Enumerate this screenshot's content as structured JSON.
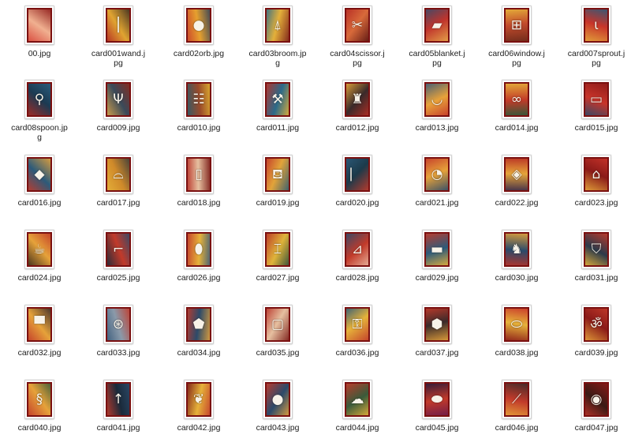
{
  "files": [
    {
      "name": "00.jpg",
      "icon": "red-swirl-icon",
      "glyph": "",
      "colors": [
        "#d8463a",
        "#f0b090",
        "#8e1c1a"
      ]
    },
    {
      "name": "card001wand.jpg",
      "icon": "wand-icon",
      "glyph": "⎮",
      "colors": [
        "#b32a22",
        "#e0a431",
        "#3a2a20"
      ]
    },
    {
      "name": "card02orb.jpg",
      "icon": "orb-icon",
      "glyph": "●",
      "colors": [
        "#c8402a",
        "#e6a02e",
        "#30405a"
      ]
    },
    {
      "name": "card03broom.jpg",
      "icon": "broom-icon",
      "glyph": "⍋",
      "colors": [
        "#2f6b8a",
        "#e4b03a",
        "#7a1c18"
      ]
    },
    {
      "name": "card04scissor.jpg",
      "icon": "scissor-icon",
      "glyph": "✂",
      "colors": [
        "#b52a24",
        "#d86a3a",
        "#5a1512"
      ]
    },
    {
      "name": "card05blanket.jpg",
      "icon": "blanket-icon",
      "glyph": "▰",
      "colors": [
        "#3a4a6a",
        "#c0342c",
        "#e6a84a"
      ]
    },
    {
      "name": "card06window.jpg",
      "icon": "window-icon",
      "glyph": "⊞",
      "colors": [
        "#e7b43a",
        "#c24a2c",
        "#6a2a1a"
      ]
    },
    {
      "name": "card007sprout.jpg",
      "icon": "sprout-icon",
      "glyph": "ɩ",
      "colors": [
        "#2a5a7a",
        "#c8342a",
        "#e3a63a"
      ]
    },
    {
      "name": "card08spoon.jpg",
      "icon": "spoon-icon",
      "glyph": "⚲",
      "colors": [
        "#2c5f80",
        "#1c3a52",
        "#a72a22"
      ]
    },
    {
      "name": "card009.jpg",
      "icon": "fork-icon",
      "glyph": "Ψ",
      "colors": [
        "#8a2a1c",
        "#3a4a5a",
        "#d8a44a"
      ]
    },
    {
      "name": "card010.jpg",
      "icon": "ladder-icon",
      "glyph": "☷",
      "colors": [
        "#e0b230",
        "#9a4a2a",
        "#2a5a6a"
      ]
    },
    {
      "name": "card011.jpg",
      "icon": "shovel-icon",
      "glyph": "⚒",
      "colors": [
        "#e6b234",
        "#2c6a8a",
        "#b83226"
      ]
    },
    {
      "name": "card012.jpg",
      "icon": "lamp-icon",
      "glyph": "♜",
      "colors": [
        "#b52e24",
        "#3a2a2a",
        "#e8a63a"
      ]
    },
    {
      "name": "card013.jpg",
      "icon": "bowl-icon",
      "glyph": "◡",
      "colors": [
        "#c4382a",
        "#e8a23a",
        "#3a5a7a"
      ]
    },
    {
      "name": "card014.jpg",
      "icon": "eggs-icon",
      "glyph": "∞",
      "colors": [
        "#2a5a3a",
        "#c23a28",
        "#e6b23a"
      ]
    },
    {
      "name": "card015.jpg",
      "icon": "rectangle-icon",
      "glyph": "▭",
      "colors": [
        "#2a4a6a",
        "#c8342a",
        "#8a1a18"
      ]
    },
    {
      "name": "card016.jpg",
      "icon": "cube-icon",
      "glyph": "◆",
      "colors": [
        "#c23a2a",
        "#2c5a7a",
        "#e6a23a"
      ]
    },
    {
      "name": "card017.jpg",
      "icon": "hat-icon",
      "glyph": "⌓",
      "colors": [
        "#e6b23a",
        "#d08a2a",
        "#3a3a3a"
      ]
    },
    {
      "name": "card018.jpg",
      "icon": "paper-icon",
      "glyph": "▯",
      "colors": [
        "#b83228",
        "#e6c0a0",
        "#7a1a16"
      ]
    },
    {
      "name": "card019.jpg",
      "icon": "watering-can-icon",
      "glyph": "⛾",
      "colors": [
        "#c23628",
        "#e2a43a",
        "#2c5a72"
      ]
    },
    {
      "name": "card020.jpg",
      "icon": "paintbrush-icon",
      "glyph": "⎸",
      "colors": [
        "#2c5a7a",
        "#1c3a4a",
        "#c23a2a"
      ]
    },
    {
      "name": "card021.jpg",
      "icon": "clock-icon",
      "glyph": "◔",
      "colors": [
        "#c43a2a",
        "#e6a23a",
        "#2c4a6a"
      ]
    },
    {
      "name": "card022.jpg",
      "icon": "box-icon",
      "glyph": "◈",
      "colors": [
        "#b83024",
        "#e6a43a",
        "#3a2a4a"
      ]
    },
    {
      "name": "card023.jpg",
      "icon": "roof-icon",
      "glyph": "⌂",
      "colors": [
        "#c8342a",
        "#8a1a18",
        "#e6a63a"
      ]
    },
    {
      "name": "card024.jpg",
      "icon": "mug-icon",
      "glyph": "☕",
      "colors": [
        "#c23a28",
        "#e6a23a",
        "#3a2a1a"
      ]
    },
    {
      "name": "card025.jpg",
      "icon": "sewing-machine-icon",
      "glyph": "⌐",
      "colors": [
        "#2c4a6a",
        "#c23a2a",
        "#1a2a3a"
      ]
    },
    {
      "name": "card026.jpg",
      "icon": "spindle-icon",
      "glyph": "⬮",
      "colors": [
        "#3a5a7a",
        "#e6b23a",
        "#c23a2a"
      ]
    },
    {
      "name": "card027.jpg",
      "icon": "bone-icon",
      "glyph": "⌶",
      "colors": [
        "#2a4a3a",
        "#e0b43a",
        "#b83226"
      ]
    },
    {
      "name": "card028.jpg",
      "icon": "horn-icon",
      "glyph": "⊿",
      "colors": [
        "#e8b8a0",
        "#c23a2a",
        "#2c4a6a"
      ]
    },
    {
      "name": "card029.jpg",
      "icon": "bar-icon",
      "glyph": "▬",
      "colors": [
        "#e6b23a",
        "#2c5a7a",
        "#c23a2a"
      ]
    },
    {
      "name": "card030.jpg",
      "icon": "llama-icon",
      "glyph": "♞",
      "colors": [
        "#b83228",
        "#2a4a6a",
        "#e6a23a"
      ]
    },
    {
      "name": "card031.jpg",
      "icon": "shield-icon",
      "glyph": "⛉",
      "colors": [
        "#e6b23a",
        "#2c3a4a",
        "#c23a2a"
      ]
    },
    {
      "name": "card032.jpg",
      "icon": "hat-brim-icon",
      "glyph": "▀",
      "colors": [
        "#c23a2a",
        "#e6a23a",
        "#3a2a2a"
      ]
    },
    {
      "name": "card033.jpg",
      "icon": "citrus-icon",
      "glyph": "⊛",
      "colors": [
        "#3a5a7a",
        "#8a9aaa",
        "#c23a2a"
      ]
    },
    {
      "name": "card034.jpg",
      "icon": "stone-icon",
      "glyph": "⬟",
      "colors": [
        "#c23a2a",
        "#2c4a6a",
        "#e6a23a"
      ]
    },
    {
      "name": "card035.jpg",
      "icon": "frame-icon",
      "glyph": "▢",
      "colors": [
        "#b83228",
        "#e6c0a0",
        "#7a1a16"
      ]
    },
    {
      "name": "card036.jpg",
      "icon": "key-icon",
      "glyph": "⚿",
      "colors": [
        "#2c5a7a",
        "#e6b23a",
        "#c23a2a"
      ]
    },
    {
      "name": "card037.jpg",
      "icon": "hexagon-icon",
      "glyph": "⬢",
      "colors": [
        "#c23a2a",
        "#3a2a2a",
        "#e6a23a"
      ]
    },
    {
      "name": "card038.jpg",
      "icon": "oval-icon",
      "glyph": "⬭",
      "colors": [
        "#c8342a",
        "#e6b23a",
        "#8a1a18"
      ]
    },
    {
      "name": "card039.jpg",
      "icon": "om-symbol-icon",
      "glyph": "ॐ",
      "colors": [
        "#c23a2a",
        "#8a1a18",
        "#e6a23a"
      ]
    },
    {
      "name": "card040.jpg",
      "icon": "spiral-shell-icon",
      "glyph": "§",
      "colors": [
        "#3a5a3a",
        "#e6a23a",
        "#c23a2a"
      ]
    },
    {
      "name": "card041.jpg",
      "icon": "arrow-up-icon",
      "glyph": "↑",
      "colors": [
        "#2c4a6a",
        "#1a2a3a",
        "#c23a2a"
      ]
    },
    {
      "name": "card042.jpg",
      "icon": "leaf-icon",
      "glyph": "❦",
      "colors": [
        "#c23a2a",
        "#e6b23a",
        "#7a1a16"
      ]
    },
    {
      "name": "card043.jpg",
      "icon": "apple-icon",
      "glyph": "●",
      "colors": [
        "#e6a23a",
        "#2c4a6a",
        "#c23a2a"
      ]
    },
    {
      "name": "card044.jpg",
      "icon": "cloud-icon",
      "glyph": "☁",
      "colors": [
        "#e6b23a",
        "#3a5a3a",
        "#c23a2a"
      ]
    },
    {
      "name": "card045.jpg",
      "icon": "lips-icon",
      "glyph": "⬬",
      "colors": [
        "#6a1a4a",
        "#c23a2a",
        "#2a1a3a"
      ]
    },
    {
      "name": "card046.jpg",
      "icon": "bat-icon",
      "glyph": "⟋",
      "colors": [
        "#e6a23a",
        "#c23a2a",
        "#3a2a2a"
      ]
    },
    {
      "name": "card047.jpg",
      "icon": "red-circle-icon",
      "glyph": "◉",
      "colors": [
        "#b83228",
        "#3a1a14",
        "#8a1a18"
      ]
    }
  ]
}
